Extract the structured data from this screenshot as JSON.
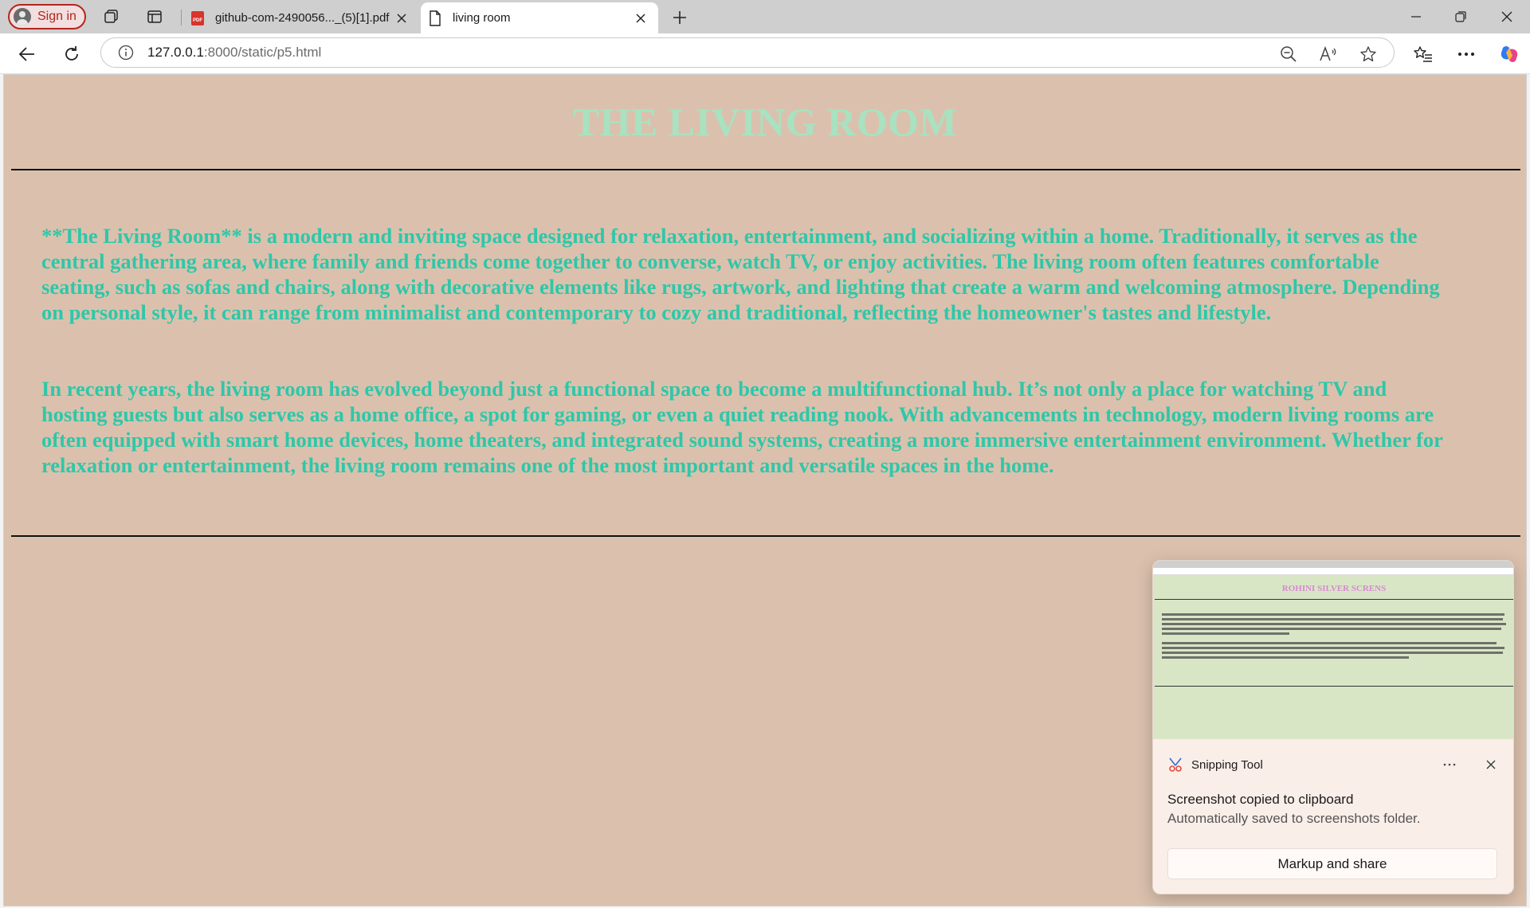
{
  "browser": {
    "signin_label": "Sign in",
    "tabs": [
      {
        "title": "github-com-2490056..._(5)[1].pdf",
        "active": false
      },
      {
        "title": "living room",
        "active": true
      }
    ],
    "url_host": "127.0.0.1",
    "url_path": ":8000/static/p5.html"
  },
  "page": {
    "heading": "THE LIVING ROOM",
    "paragraphs": [
      "**The Living Room** is a modern and inviting space designed for relaxation, entertainment, and socializing within a home. Traditionally, it serves as the central gathering area, where family and friends come together to converse, watch TV, or enjoy activities. The living room often features comfortable seating, such as sofas and chairs, along with decorative elements like rugs, artwork, and lighting that create a warm and welcoming atmosphere. Depending on personal style, it can range from minimalist and contemporary to cozy and traditional, reflecting the homeowner's tastes and lifestyle.",
      "In recent years, the living room has evolved beyond just a functional space to become a multifunctional hub. It’s not only a place for watching TV and hosting guests but also serves as a home office, a spot for gaming, or even a quiet reading nook. With advancements in technology, modern living rooms are often equipped with smart home devices, home theaters, and integrated sound systems, creating a more immersive entertainment environment. Whether for relaxation or entertainment, the living room remains one of the most important and versatile spaces in the home."
    ],
    "colors": {
      "background": "#dbc1ad",
      "heading": "#a8e2c0",
      "text": "#2ec7a9"
    }
  },
  "toast": {
    "app_name": "Snipping Tool",
    "title": "Screenshot copied to clipboard",
    "subtitle": "Automatically saved to screenshots folder.",
    "button_label": "Markup and share",
    "preview_heading": "ROHINI SILVER SCRENS"
  }
}
